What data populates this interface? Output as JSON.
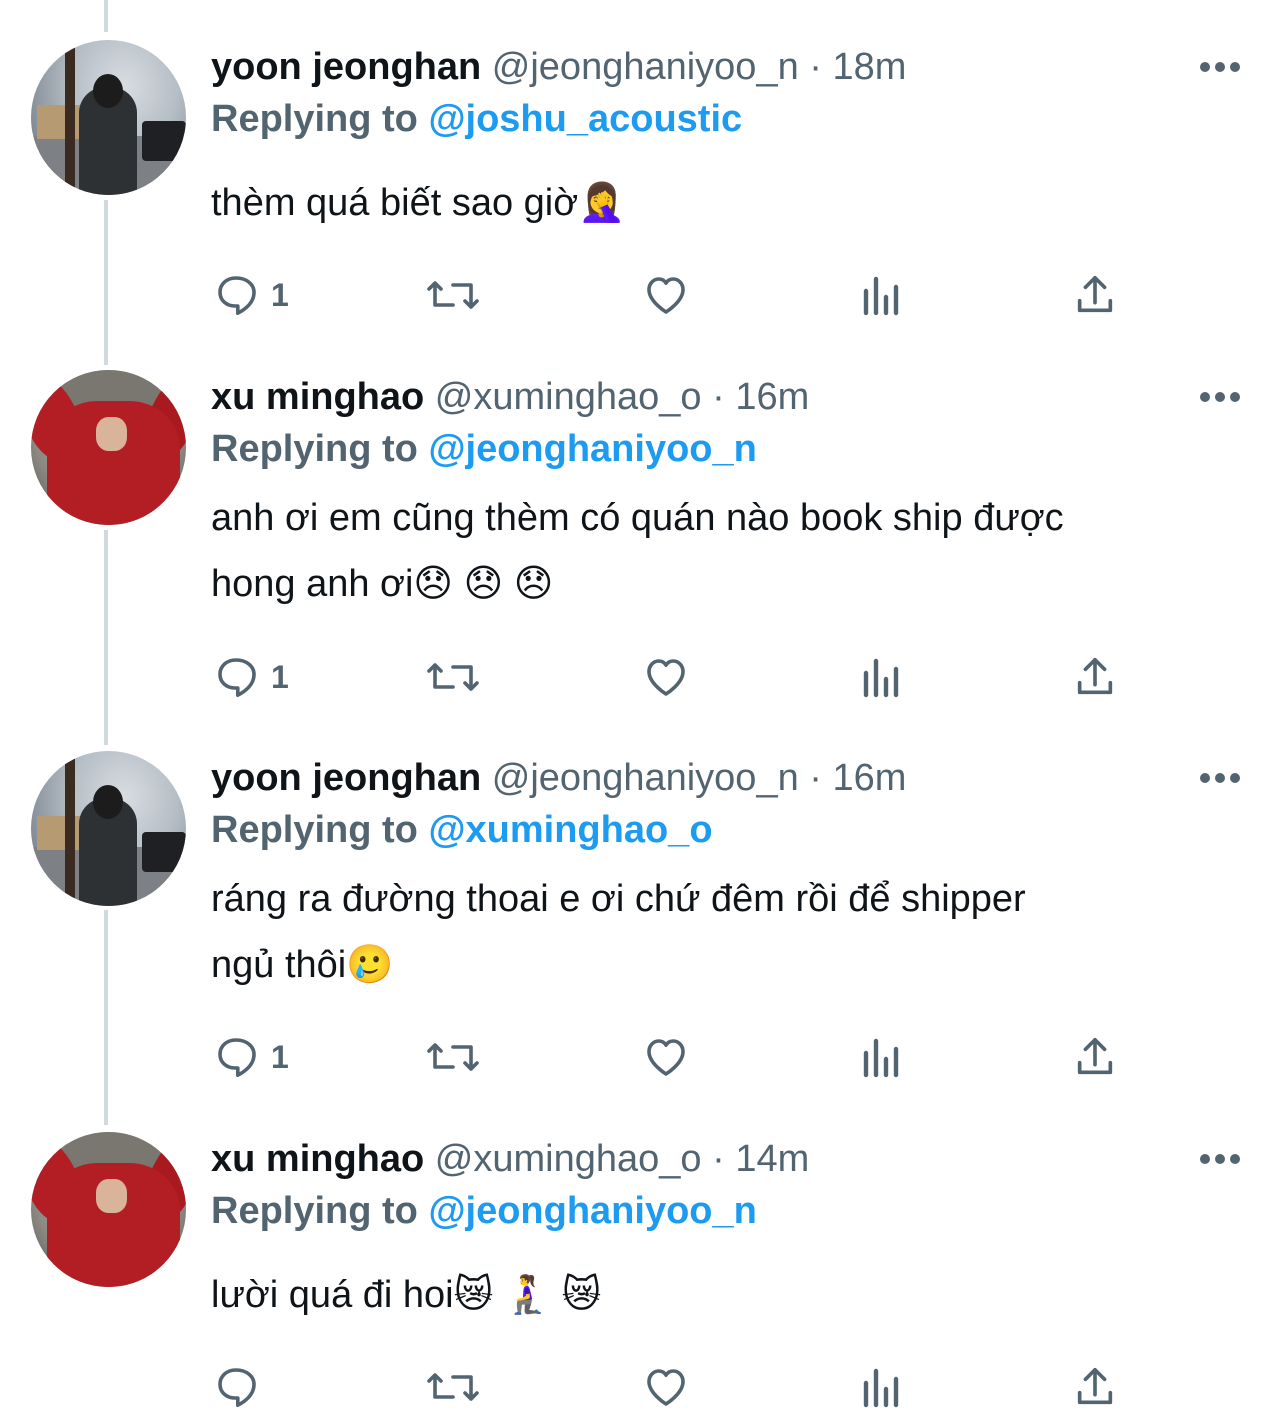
{
  "colors": {
    "link": "#1d9bf0",
    "muted": "#536471",
    "text": "#0f1419",
    "thread_line": "#cfd9de"
  },
  "tweets": [
    {
      "name": "yoon jeonghan",
      "handle": "@jeonghaniyoo_n",
      "separator": "·",
      "time": "18m",
      "replying_label": "Replying to",
      "replying_to": "@joshu_acoustic",
      "text_lines": [
        "thèm quá biết sao giờ🤦‍♀️"
      ],
      "reply_count": "1",
      "avatar": "paris-street-avatar"
    },
    {
      "name": "xu minghao",
      "handle": "@xuminghao_o",
      "separator": "·",
      "time": "16m",
      "replying_label": "Replying to",
      "replying_to": "@jeonghaniyoo_n",
      "text_lines": [
        "anh ơi em cũng thèm có quán nào book ship được",
        "hong anh ơi😞 😞 😞"
      ],
      "reply_count": "1",
      "avatar": "red-hoodie-avatar"
    },
    {
      "name": "yoon jeonghan",
      "handle": "@jeonghaniyoo_n",
      "separator": "·",
      "time": "16m",
      "replying_label": "Replying to",
      "replying_to": "@xuminghao_o",
      "text_lines": [
        "ráng ra đường thoai e ơi chứ đêm rồi để shipper",
        "ngủ thôi🥲"
      ],
      "reply_count": "1",
      "avatar": "paris-street-avatar"
    },
    {
      "name": "xu minghao",
      "handle": "@xuminghao_o",
      "separator": "·",
      "time": "14m",
      "replying_label": "Replying to",
      "replying_to": "@jeonghaniyoo_n",
      "text_lines": [
        "lười quá đi hoi😿 🧎‍♀️ 😿"
      ],
      "reply_count": "",
      "avatar": "red-hoodie-avatar"
    }
  ],
  "icons": {
    "reply": "reply-bubble-icon",
    "retweet": "retweet-icon",
    "like": "heart-icon",
    "views": "analytics-bars-icon",
    "share": "share-upload-icon",
    "more": "more-dots-icon"
  }
}
